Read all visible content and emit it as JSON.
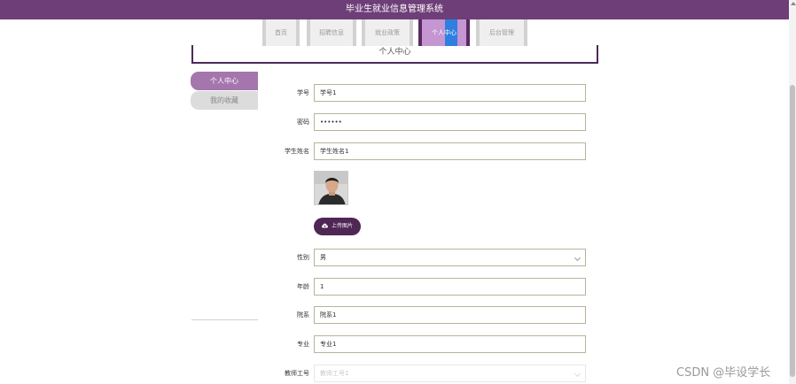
{
  "header": {
    "title": "毕业生就业信息管理系统"
  },
  "nav": {
    "tabs": [
      {
        "label": "首页"
      },
      {
        "label": "招聘信息"
      },
      {
        "label": "就业政策"
      },
      {
        "label": "个人中心"
      },
      {
        "label": "后台管理"
      }
    ],
    "active": "个人中心"
  },
  "page": {
    "title": "个人中心"
  },
  "side_menu": {
    "items": [
      {
        "label": "个人中心"
      },
      {
        "label": "我的收藏"
      }
    ]
  },
  "form": {
    "student_no": {
      "label": "学号",
      "value": "学号1"
    },
    "password": {
      "label": "密码",
      "value": "••••••"
    },
    "student_name": {
      "label": "学生姓名",
      "value": "学生姓名1"
    },
    "upload_label": "上传图片",
    "gender": {
      "label": "性别",
      "value": "男"
    },
    "age": {
      "label": "年龄",
      "value": "1"
    },
    "department": {
      "label": "院系",
      "value": "院系1"
    },
    "major": {
      "label": "专业",
      "value": "专业1"
    },
    "teacher_no": {
      "label": "教师工号",
      "placeholder": "教师工号1"
    }
  },
  "watermark": "CSDN @毕设学长",
  "colors": {
    "header_bg": "#6e3e78",
    "tab_active": "#c496d2",
    "side_active": "#a576ad",
    "upload_btn": "#4f2754"
  }
}
